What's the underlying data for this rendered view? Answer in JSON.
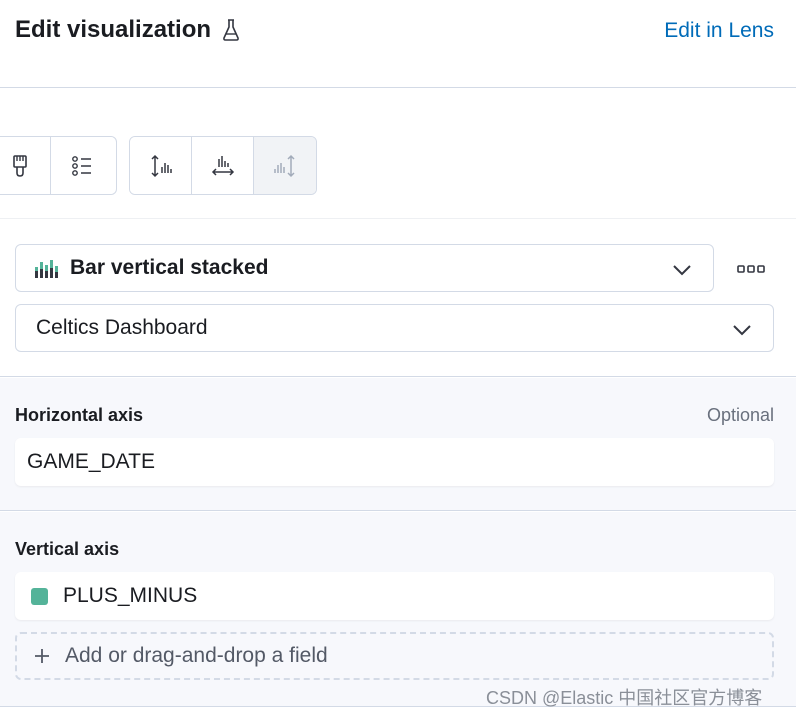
{
  "header": {
    "title": "Edit visualization",
    "edit_in_lens": "Edit in Lens"
  },
  "toolbar": {
    "group1": [
      "paintbrush-icon",
      "legend-icon"
    ],
    "group2": [
      "left-axis-icon",
      "bottom-axis-icon",
      "right-axis-icon"
    ]
  },
  "chart_type": {
    "label": "Bar vertical stacked",
    "icon": "bar-stacked-icon"
  },
  "layer": {
    "label": "Celtics Dashboard"
  },
  "horizontal_axis": {
    "title": "Horizontal axis",
    "optional": "Optional",
    "field": "GAME_DATE"
  },
  "vertical_axis": {
    "title": "Vertical axis",
    "field": "PLUS_MINUS",
    "field_color": "#54b399",
    "add_field": "Add or drag-and-drop a field"
  },
  "watermark": "CSDN @Elastic 中国社区官方博客"
}
